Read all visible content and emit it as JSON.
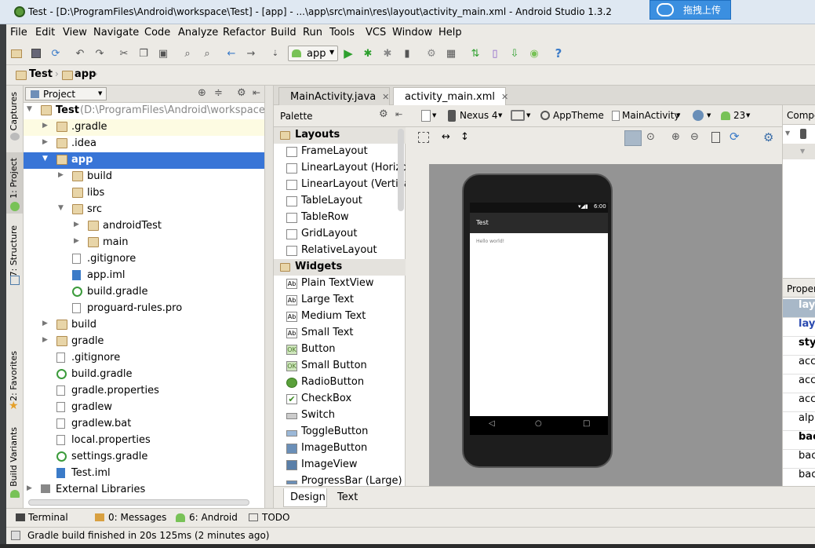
{
  "window": {
    "title": "Test - [D:\\ProgramFiles\\Android\\workspace\\Test] - [app] - ...\\app\\src\\main\\res\\layout\\activity_main.xml - Android Studio 1.3.2",
    "upload_button": "拖拽上传"
  },
  "menu": [
    "File",
    "Edit",
    "View",
    "Navigate",
    "Code",
    "Analyze",
    "Refactor",
    "Build",
    "Run",
    "Tools",
    "VCS",
    "Window",
    "Help"
  ],
  "toolbar": {
    "run_config": "app"
  },
  "breadcrumb": {
    "project": "Test",
    "module": "app"
  },
  "side_tabs": {
    "captures": "Captures",
    "project": "1: Project",
    "structure": "7: Structure",
    "favorites": "2: Favorites",
    "build_variants": "Build Variants"
  },
  "project_panel": {
    "view_selector": "Project",
    "tree": [
      {
        "label": "Test",
        "path": "(D:\\ProgramFiles\\Android\\workspace\\Te",
        "bold": true
      },
      {
        "label": ".gradle"
      },
      {
        "label": ".idea"
      },
      {
        "label": "app"
      },
      {
        "label": "build"
      },
      {
        "label": "libs"
      },
      {
        "label": "src"
      },
      {
        "label": "androidTest"
      },
      {
        "label": "main"
      },
      {
        "label": ".gitignore"
      },
      {
        "label": "app.iml"
      },
      {
        "label": "build.gradle"
      },
      {
        "label": "proguard-rules.pro"
      },
      {
        "label": "build"
      },
      {
        "label": "gradle"
      },
      {
        "label": ".gitignore"
      },
      {
        "label": "build.gradle"
      },
      {
        "label": "gradle.properties"
      },
      {
        "label": "gradlew"
      },
      {
        "label": "gradlew.bat"
      },
      {
        "label": "local.properties"
      },
      {
        "label": "settings.gradle"
      },
      {
        "label": "Test.iml"
      },
      {
        "label": "External Libraries"
      }
    ]
  },
  "editor_tabs": [
    {
      "label": "MainActivity.java",
      "active": false
    },
    {
      "label": "activity_main.xml",
      "active": true
    }
  ],
  "palette": {
    "title": "Palette",
    "items": [
      {
        "label": "Layouts",
        "category": true
      },
      {
        "label": "FrameLayout"
      },
      {
        "label": "LinearLayout (Horizontal)"
      },
      {
        "label": "LinearLayout (Vertical)"
      },
      {
        "label": "TableLayout"
      },
      {
        "label": "TableRow"
      },
      {
        "label": "GridLayout"
      },
      {
        "label": "RelativeLayout"
      },
      {
        "label": "Widgets",
        "category": true
      },
      {
        "label": "Plain TextView",
        "icon": "Ab"
      },
      {
        "label": "Large Text",
        "icon": "Ab"
      },
      {
        "label": "Medium Text",
        "icon": "Ab"
      },
      {
        "label": "Small Text",
        "icon": "Ab"
      },
      {
        "label": "Button",
        "icon": "OK"
      },
      {
        "label": "Small Button",
        "icon": "OK"
      },
      {
        "label": "RadioButton"
      },
      {
        "label": "CheckBox"
      },
      {
        "label": "Switch"
      },
      {
        "label": "ToggleButton"
      },
      {
        "label": "ImageButton"
      },
      {
        "label": "ImageView"
      },
      {
        "label": "ProgressBar (Large)"
      }
    ]
  },
  "design_toolbar": {
    "device": "Nexus 4",
    "theme": "AppTheme",
    "activity": "MainActivity",
    "api": "23"
  },
  "phone": {
    "time": "6:00",
    "app_title": "Test",
    "content": "Hello world!"
  },
  "component_panel": {
    "title": "Compo"
  },
  "properties_panel": {
    "title": "Propert",
    "rows": [
      "layo",
      "layo",
      "styl",
      "acce",
      "acce",
      "acce",
      "alph",
      "bac",
      "bac",
      "bac"
    ]
  },
  "bottom_tabs": {
    "design": "Design",
    "text": "Text"
  },
  "tool_windows": [
    {
      "label": "Terminal"
    },
    {
      "label": "0: Messages"
    },
    {
      "label": "6: Android"
    },
    {
      "label": "TODO"
    }
  ],
  "status": {
    "message": "Gradle build finished in 20s 125ms (2 minutes ago)"
  },
  "colors": {
    "selection": "#3875d7",
    "accent": "#3b8fe0",
    "android_green": "#78c257"
  }
}
